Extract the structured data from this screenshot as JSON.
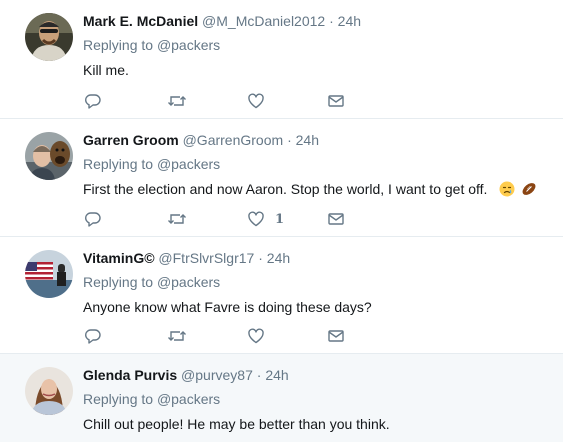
{
  "tweets": [
    {
      "name": "Mark E. McDaniel",
      "handle": "@M_McDaniel2012",
      "dot": "·",
      "time": "24h",
      "reply_prefix": "Replying to",
      "reply_to": "@packers",
      "text": "Kill me.",
      "like_count": "",
      "highlight": false
    },
    {
      "name": "Garren Groom",
      "handle": "@GarrenGroom",
      "dot": "·",
      "time": "24h",
      "reply_prefix": "Replying to",
      "reply_to": "@packers",
      "text": "First the election and now Aaron.  Stop the world, I want to get off.",
      "like_count": "1",
      "emojis": [
        "crying-face-emoji",
        "football-emoji"
      ],
      "highlight": false
    },
    {
      "name": "VitaminG©",
      "handle": "@FtrSlvrSlgr17",
      "dot": "·",
      "time": "24h",
      "reply_prefix": "Replying to",
      "reply_to": "@packers",
      "text": "Anyone know what Favre is doing these days?",
      "like_count": "",
      "highlight": false
    },
    {
      "name": "Glenda Purvis",
      "handle": "@purvey87",
      "dot": "·",
      "time": "24h",
      "reply_prefix": "Replying to",
      "reply_to": "@packers",
      "text": "Chill out people!  He may be better than you think.",
      "like_count": "",
      "highlight": true
    }
  ],
  "icons": {
    "reply": "reply-icon",
    "retweet": "retweet-icon",
    "like": "heart-icon",
    "dm": "envelope-icon"
  },
  "colors": {
    "icon_gray": "#657786",
    "divider": "#e6ecf0",
    "highlight_bg": "#f5f8fa"
  }
}
